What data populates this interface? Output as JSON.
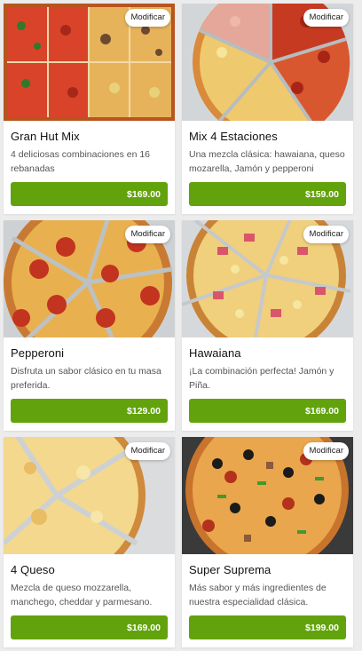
{
  "modify_label": "Modificar",
  "accent_color": "#62a30d",
  "products": [
    {
      "name": "Gran Hut Mix",
      "description": "4 deliciosas combinaciones en 16 rebanadas",
      "price": "$169.00"
    },
    {
      "name": "Mix 4 Estaciones",
      "description": "Una mezcla clásica: hawaiana, queso mozarella, Jamón y pepperoni",
      "price": "$159.00"
    },
    {
      "name": "Pepperoni",
      "description": "Disfruta un sabor clásico en tu masa preferida.",
      "price": "$129.00"
    },
    {
      "name": "Hawaiana",
      "description": "¡La combinación perfecta! Jamón y Piña.",
      "price": "$169.00"
    },
    {
      "name": "4 Queso",
      "description": "Mezcla de queso mozzarella, manchego, cheddar y parmesano.",
      "price": "$169.00"
    },
    {
      "name": "Super Suprema",
      "description": "Más sabor y más ingredientes de nuestra especialidad clásica.",
      "price": "$199.00"
    }
  ]
}
